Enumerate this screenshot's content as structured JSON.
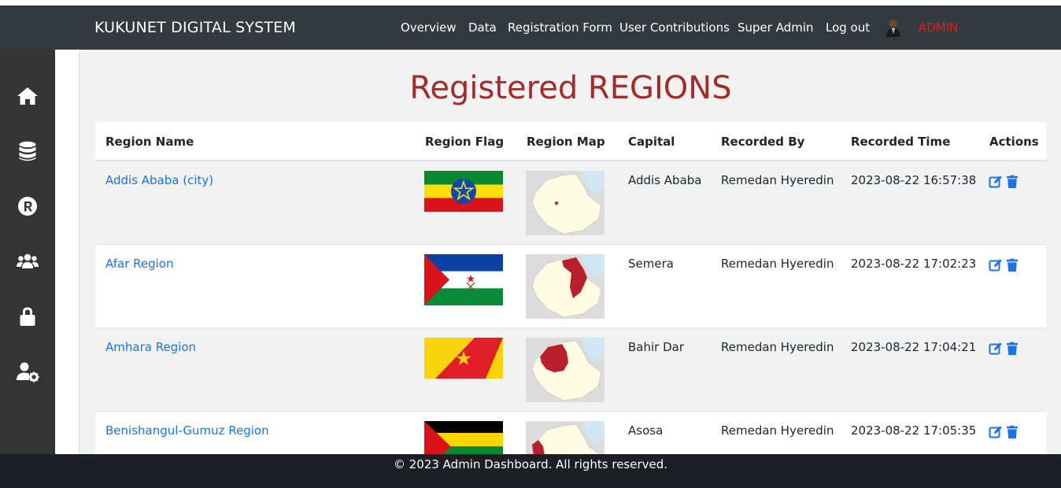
{
  "navbar": {
    "brand": "KUKUNET DIGITAL SYSTEM",
    "links": [
      "Overview",
      "Data",
      "Registration Form",
      "User Contributions",
      "Super Admin",
      "Log out"
    ],
    "user_label": "ADMIN",
    "user_label_color": "#e01f1f"
  },
  "sidebar": {
    "icons": [
      "home-icon",
      "database-icon",
      "registered-icon",
      "users-icon",
      "lock-icon",
      "user-settings-icon"
    ]
  },
  "page": {
    "title": "Registered REGIONS",
    "title_color": "#a52a2a"
  },
  "table": {
    "headers": [
      "Region Name",
      "Region Flag",
      "Region Map",
      "Capital",
      "Recorded By",
      "Recorded Time",
      "Actions"
    ],
    "rows": [
      {
        "name": "Addis Ababa (city)",
        "capital": "Addis Ababa",
        "recorded_by": "Remedan Hyeredin",
        "recorded_time": "2023-08-22 16:57:38"
      },
      {
        "name": "Afar Region",
        "capital": "Semera",
        "recorded_by": "Remedan Hyeredin",
        "recorded_time": "2023-08-22 17:02:23"
      },
      {
        "name": "Amhara Region",
        "capital": "Bahir Dar",
        "recorded_by": "Remedan Hyeredin",
        "recorded_time": "2023-08-22 17:04:21"
      },
      {
        "name": "Benishangul-Gumuz Region",
        "capital": "Asosa",
        "recorded_by": "Remedan Hyeredin",
        "recorded_time": "2023-08-22 17:05:35"
      }
    ],
    "action_icons": [
      "edit-icon",
      "trash-icon"
    ],
    "link_color": "#1a73e8",
    "action_color": "#1a73e8"
  },
  "footer": {
    "text": "© 2023 Admin Dashboard. All rights reserved."
  }
}
